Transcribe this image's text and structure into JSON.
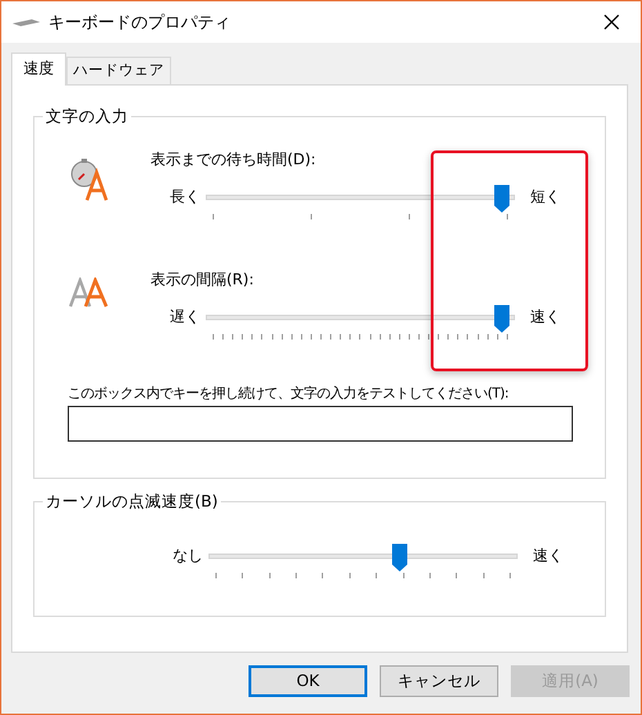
{
  "window": {
    "title": "キーボードのプロパティ"
  },
  "tabs": [
    {
      "label": "速度",
      "selected": true
    },
    {
      "label": "ハードウェア",
      "selected": false
    }
  ],
  "groups": [
    {
      "title": "文字の入力",
      "sliders": [
        {
          "kind": "delay",
          "label": "表示までの待ち時間(D):",
          "min_label": "長く",
          "max_label": "短く",
          "level": 1
        },
        {
          "kind": "rate",
          "label": "表示の間隔(R):",
          "min_label": "遅く",
          "max_label": "速く",
          "level": 1
        }
      ],
      "test_field": {
        "label": "このボックス内でキーを押し続けて、文字の入力をテストしてください(T):"
      }
    },
    {
      "title": "カーソルの点滅速度(B)",
      "sliders": [
        {
          "kind": "blink",
          "min_label": "なし",
          "max_label": "速く",
          "level": 0.636
        }
      ]
    }
  ],
  "buttons": [
    {
      "label": "OK",
      "default": true,
      "disabled": false
    },
    {
      "label": "キャンセル",
      "default": false,
      "disabled": false
    },
    {
      "label": "適用(A)",
      "default": false,
      "disabled": true
    }
  ]
}
